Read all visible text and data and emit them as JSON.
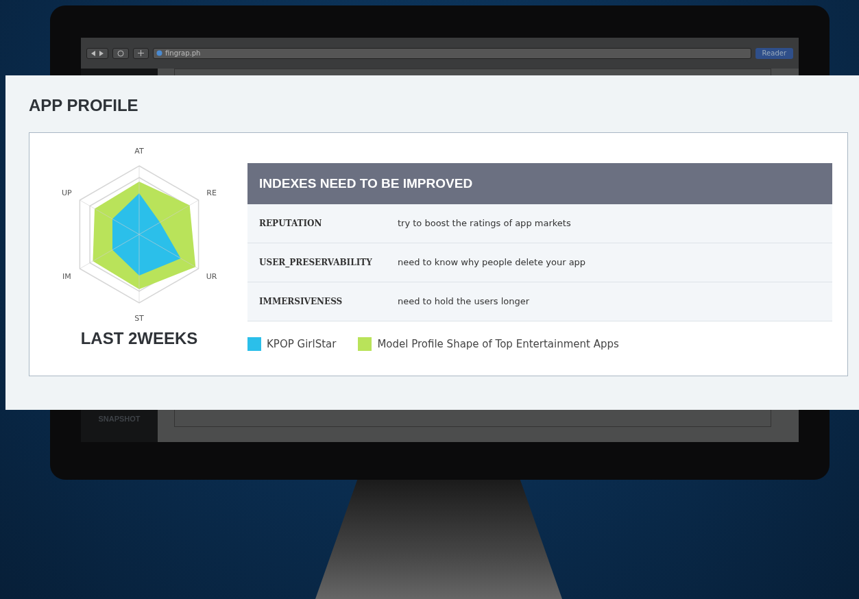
{
  "browser": {
    "address": "fingrap.ph",
    "reader_button": "Reader"
  },
  "sidebar": {
    "items": [
      "SNAPSHOT"
    ]
  },
  "panel": {
    "title": "APP PROFILE",
    "radar": {
      "axes": [
        "AT",
        "RE",
        "UR",
        "ST",
        "IM",
        "UP"
      ],
      "caption": "LAST 2WEEKS"
    },
    "table": {
      "heading": "INDEXES NEED TO BE IMPROVED",
      "rows": [
        {
          "index": "REPUTATION",
          "advice": "try to boost the ratings of app markets"
        },
        {
          "index": "USER_PRESERVABILITY",
          "advice": "need to know why people delete your app"
        },
        {
          "index": "IMMERSIVENESS",
          "advice": "need to hold the users longer"
        }
      ]
    },
    "legend": [
      {
        "label": "KPOP GirlStar",
        "color": "#2bbfea"
      },
      {
        "label": "Model Profile Shape of Top Entertainment Apps",
        "color": "#b9e35a"
      }
    ]
  }
}
